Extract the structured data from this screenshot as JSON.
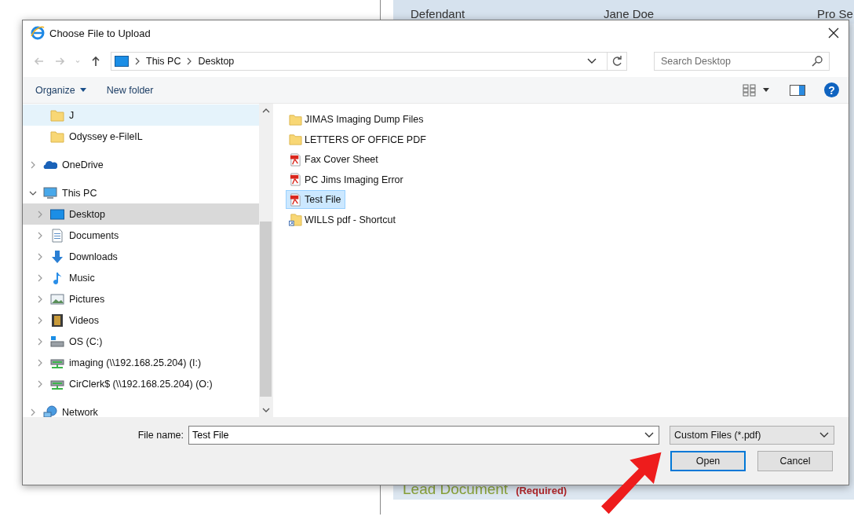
{
  "background_page": {
    "party_row": {
      "role": "Defendant",
      "name": "Jane Doe",
      "representation": "Pro Se"
    },
    "section": {
      "title": "Lead Document",
      "note": "(Required)"
    }
  },
  "dialog": {
    "title": "Choose File to Upload",
    "nav_buttons": [
      {
        "kind": "back",
        "disabled": true
      },
      {
        "kind": "forward",
        "disabled": true
      },
      {
        "kind": "recent",
        "disabled": true
      },
      {
        "kind": "up",
        "disabled": false
      }
    ],
    "address": {
      "path": [
        "This PC",
        "Desktop"
      ]
    },
    "search": {
      "placeholder": "Search Desktop"
    },
    "toolbar": {
      "items": [
        {
          "label": "Organize",
          "kind": "menu"
        },
        {
          "label": "New folder",
          "kind": "button"
        }
      ],
      "help_glyph": "?"
    },
    "nav": [
      {
        "children": [
          {
            "label": "J",
            "kind": "folder",
            "selected": false,
            "hovered": true
          },
          {
            "label": "Odyssey e-FileIL",
            "kind": "folder",
            "selected": false,
            "hovered": false
          }
        ]
      },
      {
        "label": "OneDrive",
        "kind": "cloud",
        "expanded": false,
        "selected": false,
        "hovered": false
      },
      {
        "label": "This PC",
        "kind": "computer",
        "expanded": true,
        "selected": false,
        "hovered": false,
        "children": [
          {
            "label": "Desktop",
            "kind": "desktop",
            "expanded": false,
            "selected": true,
            "hovered": false
          },
          {
            "label": "Documents",
            "kind": "documents",
            "expanded": false,
            "selected": false,
            "hovered": false
          },
          {
            "label": "Downloads",
            "kind": "downloads",
            "expanded": false,
            "selected": false,
            "hovered": false
          },
          {
            "label": "Music",
            "kind": "music",
            "expanded": false,
            "selected": false,
            "hovered": false
          },
          {
            "label": "Pictures",
            "kind": "pictures",
            "expanded": false,
            "selected": false,
            "hovered": false
          },
          {
            "label": "Videos",
            "kind": "videos",
            "expanded": false,
            "selected": false,
            "hovered": false
          },
          {
            "label": "OS (C:)",
            "kind": "drive",
            "expanded": false,
            "selected": false,
            "hovered": false
          },
          {
            "label": "imaging (\\\\192.168.25.204) (I:)",
            "kind": "netdrive",
            "expanded": false,
            "selected": false,
            "hovered": false
          },
          {
            "label": "CirClerk$ (\\\\192.168.25.204) (O:)",
            "kind": "netdrive",
            "expanded": false,
            "selected": false,
            "hovered": false
          }
        ]
      },
      {
        "label": "Network",
        "kind": "network",
        "expanded": false,
        "selected": false,
        "hovered": false
      }
    ],
    "files": [
      {
        "name": "JIMAS Imaging Dump Files",
        "kind": "folder",
        "selected": false
      },
      {
        "name": "LETTERS OF OFFICE PDF",
        "kind": "folder",
        "selected": false
      },
      {
        "name": "Fax Cover Sheet",
        "kind": "pdf",
        "selected": false
      },
      {
        "name": "PC Jims Imaging Error",
        "kind": "pdf",
        "selected": false
      },
      {
        "name": "Test File",
        "kind": "pdf",
        "selected": true
      },
      {
        "name": "WILLS pdf - Shortcut",
        "kind": "shortcut",
        "selected": false
      }
    ],
    "file_name": {
      "label": "File name:",
      "value": "Test File"
    },
    "file_type": {
      "value": "Custom Files (*.pdf)"
    },
    "buttons": [
      {
        "label": "Open",
        "default": true
      },
      {
        "label": "Cancel",
        "default": false
      }
    ]
  }
}
